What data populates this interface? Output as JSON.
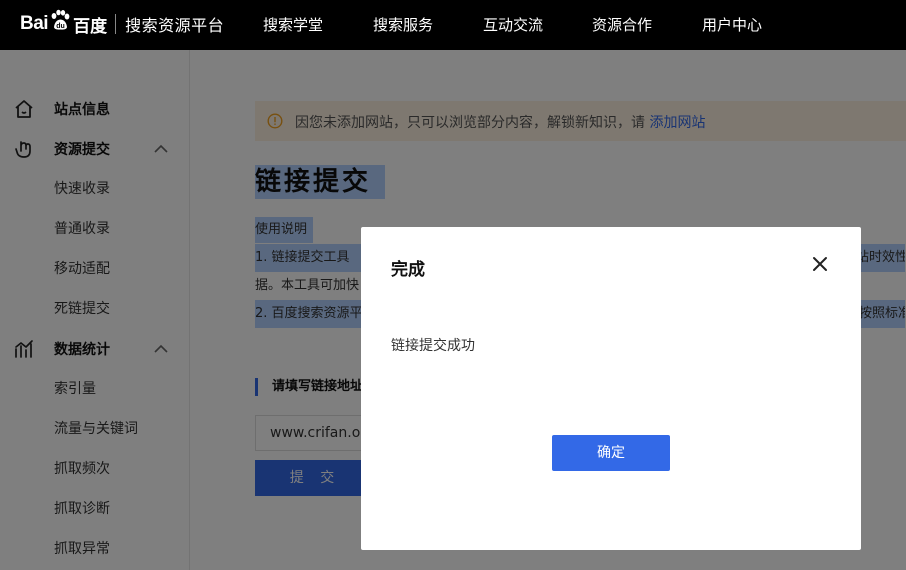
{
  "header": {
    "logo_text_left": "Bai",
    "logo_text_right": "百度",
    "platform": "搜索资源平台",
    "nav": [
      "搜索学堂",
      "搜索服务",
      "互动交流",
      "资源合作",
      "用户中心"
    ]
  },
  "sidebar": {
    "groups": [
      {
        "label": "站点信息",
        "icon": "home-icon",
        "items": []
      },
      {
        "label": "资源提交",
        "icon": "link-hand-icon",
        "items": [
          "快速收录",
          "普通收录",
          "移动适配",
          "死链提交"
        ]
      },
      {
        "label": "数据统计",
        "icon": "chart-icon",
        "items": [
          "索引量",
          "流量与关键词",
          "抓取频次",
          "抓取诊断",
          "抓取异常"
        ]
      }
    ]
  },
  "main": {
    "notice_text": "因您未添加网站，只可以浏览部分内容，解锁新知识，请",
    "notice_link": "添加网站",
    "page_title": "链接提交",
    "usage_title": "使用说明",
    "usage_line1_start": "1. 链接提交工具",
    "usage_line1_end": "站时效性",
    "usage_line2": "据。本工具可加快",
    "usage_line3_start": "2. 百度搜索资源平",
    "usage_line3_end": "按照标准",
    "section_title": "请填写链接地址",
    "url_value": "www.crifan.org",
    "submit_label": "提 交"
  },
  "modal": {
    "title": "完成",
    "message": "链接提交成功",
    "ok_label": "确定"
  },
  "colors": {
    "accent": "#3369e7",
    "notice_bg": "#fdf1e1",
    "notice_icon": "#f0a020",
    "selection": "#b3d1ff"
  }
}
